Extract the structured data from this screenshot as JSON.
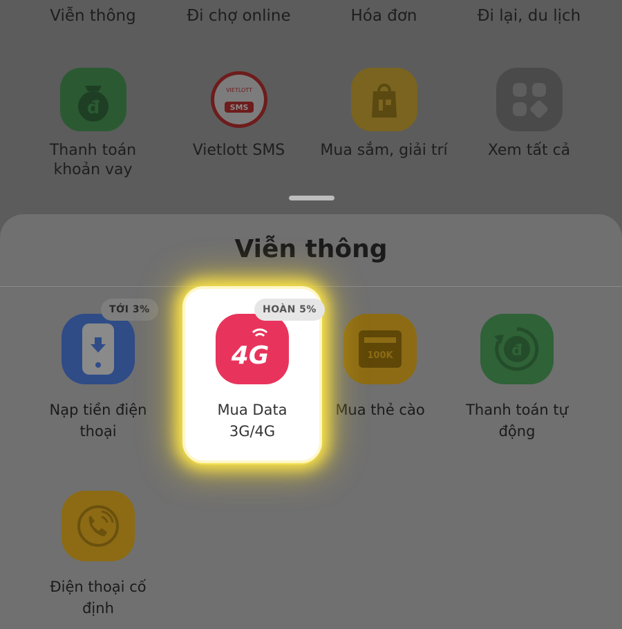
{
  "categories": [
    "Viễn thông",
    "Đi chợ online",
    "Hóa đơn",
    "Đi lại, du lịch"
  ],
  "background_services": [
    {
      "label_line1": "Thanh toán",
      "label_line2": "khoản vay",
      "icon": "loan-payment-icon",
      "color": "#2b5a32"
    },
    {
      "label_line1": "Vietlott SMS",
      "label_line2": "",
      "icon": "vietlott-sms-icon",
      "color": "#6e1c1c"
    },
    {
      "label_line1": "Mua sắm, giải trí",
      "label_line2": "",
      "icon": "shopping-bag-icon",
      "color": "#7a6420"
    },
    {
      "label_line1": "Xem tất cả",
      "label_line2": "",
      "icon": "grid-icon",
      "color": "#4a4a4a"
    }
  ],
  "vietlott_icon_text": {
    "top": "VIETLOTT",
    "bottom": "SMS"
  },
  "sheet": {
    "title": "Viễn thông",
    "items": [
      {
        "label_line1": "Nạp tiền điện",
        "label_line2": "thoại",
        "badge": "TỚI 3%",
        "icon": "phone-topup-icon",
        "color": "#2f4c87"
      },
      {
        "label_line1": "Mua Data",
        "label_line2": "3G/4G",
        "badge": "HOÀN 5%",
        "icon": "4g-data-icon",
        "icon_text": "4G",
        "color": "#e8345c"
      },
      {
        "label_line1": "Mua thẻ cào",
        "label_line2": "",
        "badge": "",
        "icon": "scratch-card-icon",
        "icon_text": "100K",
        "color": "#8c6b14"
      },
      {
        "label_line1": "Thanh toán tự",
        "label_line2": "động",
        "badge": "",
        "icon": "auto-payment-icon",
        "color": "#2f6237"
      },
      {
        "label_line1": "Điện thoại cố",
        "label_line2": "định",
        "badge": "",
        "icon": "landline-phone-icon",
        "color": "#8c6b14"
      }
    ]
  }
}
